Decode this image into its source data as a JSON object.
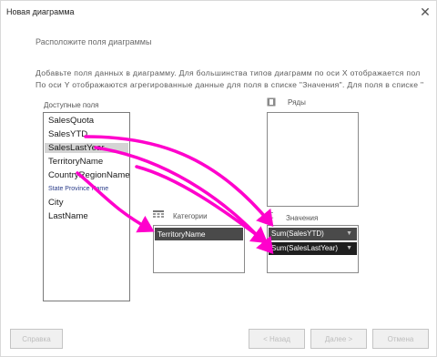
{
  "dialog": {
    "title": "Новая диаграмма",
    "close_glyph": "✕",
    "subtitle": "Расположите поля диаграммы",
    "instructions": [
      "Добавьте поля данных в диаграмму. Для большинства типов диаграмм по оси X отображается пол",
      "По оси Y отображаются агрегированные данные для поля в списке \"Значения\". Для поля в списке \""
    ]
  },
  "available_fields": {
    "label": "Доступные поля",
    "items": [
      "SalesQuota",
      "SalesYTD",
      "SalesLastYear",
      "TerritoryName",
      "CountryRegionName",
      "State Province Name",
      "City",
      "LastName"
    ],
    "selected_index": 2
  },
  "series": {
    "label": "Ряды",
    "items": []
  },
  "categories": {
    "label": "Категории",
    "items": [
      "TerritoryName"
    ]
  },
  "values": {
    "label": "Значения",
    "items": [
      {
        "label": "Sum(SalesYTD)",
        "dropdown_glyph": "▼"
      },
      {
        "label": "Sum(SalesLastYear)",
        "dropdown_glyph": "▼"
      }
    ]
  },
  "footer": {
    "back_label": "< Назад",
    "next_label": "Далее >",
    "cancel_label": "Отмена",
    "left_label": "Справка"
  },
  "colors": {
    "arrow": "#ff00cc",
    "pill_dark": "#1f1f1f",
    "pill_gray": "#4a4a4a",
    "selection": "#d4d4d4"
  }
}
